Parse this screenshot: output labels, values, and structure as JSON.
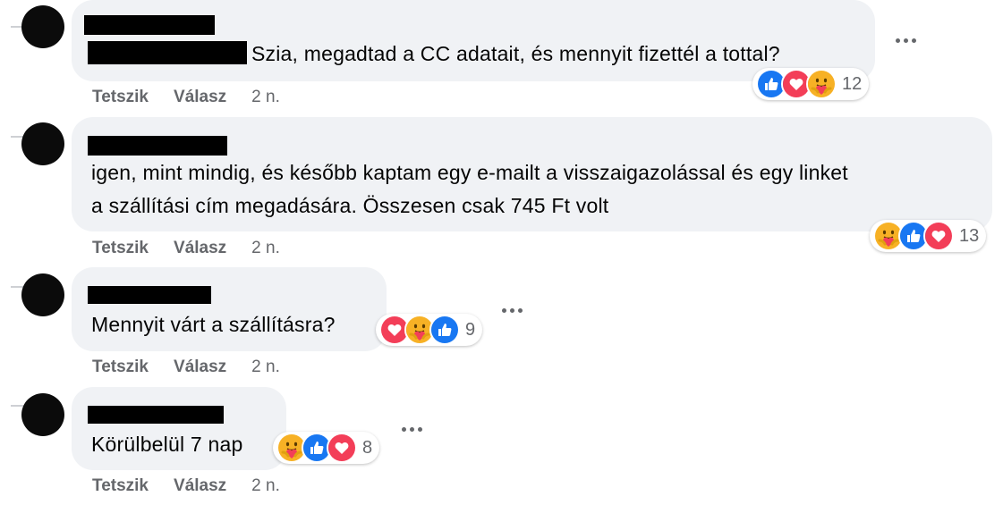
{
  "comments": [
    {
      "text_lines": [
        "Szia, megadtad a CC adatait, és mennyit fizettél a tottal?"
      ],
      "reaction_icons": [
        "like-icon",
        "love-icon",
        "care-icon"
      ],
      "reaction_count": "12",
      "actions": {
        "like": "Tetszik",
        "reply": "Válasz",
        "time": "2 n."
      }
    },
    {
      "text_lines": [
        "igen, mint mindig, és később kaptam egy e-mailt a visszaigazolással és egy linket",
        "a szállítási cím megadására. Összesen csak 745 Ft volt"
      ],
      "reaction_icons": [
        "care-icon",
        "like-icon",
        "love-icon"
      ],
      "reaction_count": "13",
      "actions": {
        "like": "Tetszik",
        "reply": "Válasz",
        "time": "2 n."
      }
    },
    {
      "text_lines": [
        "Mennyit várt a szállításra?"
      ],
      "reaction_icons": [
        "love-icon",
        "care-icon",
        "like-icon"
      ],
      "reaction_count": "9",
      "actions": {
        "like": "Tetszik",
        "reply": "Válasz",
        "time": "2 n."
      }
    },
    {
      "text_lines": [
        "Körülbelül 7 nap"
      ],
      "reaction_icons": [
        "care-icon",
        "like-icon",
        "love-icon"
      ],
      "reaction_count": "8",
      "actions": {
        "like": "Tetszik",
        "reply": "Válasz",
        "time": "2 n."
      }
    }
  ],
  "colors": {
    "bubble": "#f0f2f5",
    "secondary_text": "#65676b",
    "like": "#1877f2",
    "love": "#f33e58",
    "care": "#f7b125"
  }
}
